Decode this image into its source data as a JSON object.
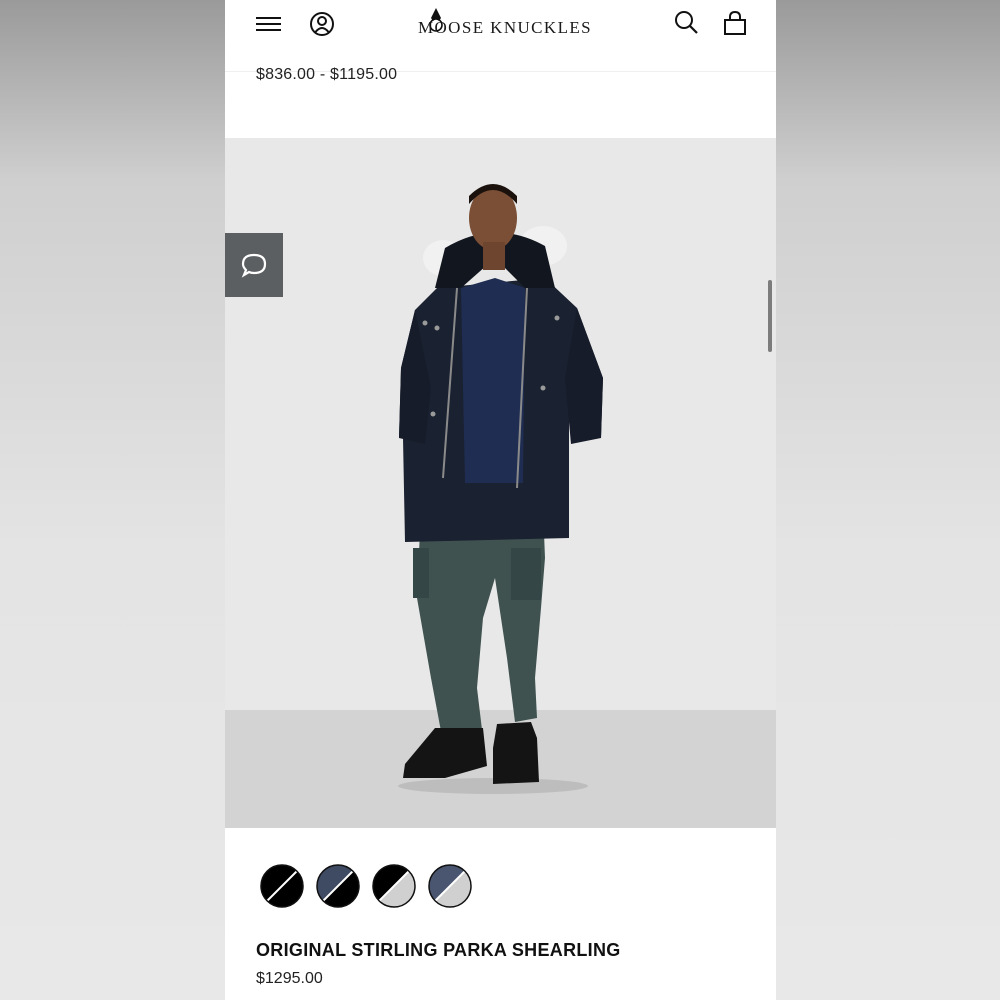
{
  "header": {
    "brand": "MOOSE KNUCKLES",
    "icons": [
      "menu-icon",
      "account-icon",
      "search-icon",
      "bag-icon"
    ]
  },
  "previous_item": {
    "price_range": "$836.00 - $1195.00"
  },
  "product": {
    "image": "model-wearing-parka",
    "name": "ORIGINAL STIRLING PARKA SHEARLING",
    "price": "$1295.00",
    "swatches": [
      {
        "name": "black-black",
        "colors": [
          "#000000",
          "#000000"
        ]
      },
      {
        "name": "navy-black",
        "colors": [
          "#3f4a63",
          "#000000"
        ]
      },
      {
        "name": "black-grey",
        "colors": [
          "#000000",
          "#d0d0d0"
        ]
      },
      {
        "name": "navy-grey",
        "colors": [
          "#4a5670",
          "#d0d0d0"
        ]
      }
    ]
  },
  "chat": {
    "icon": "chat-bubble-icon"
  },
  "colors": {
    "accent": "#5c5f62",
    "text": "#111111"
  }
}
